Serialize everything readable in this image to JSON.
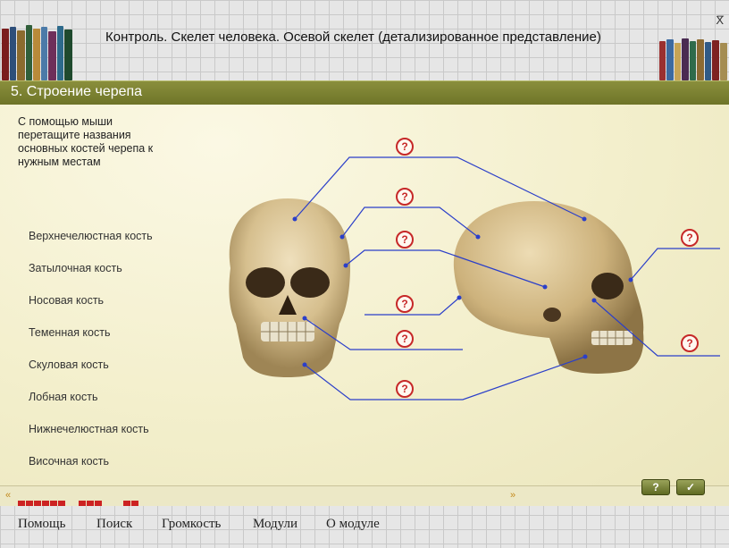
{
  "window": {
    "minimize": "_",
    "close": "X"
  },
  "title": "Контроль. Скелет человека. Осевой скелет (детализированное представление)",
  "section": {
    "title": "5. Строение черепа"
  },
  "instruction": "С помощью мыши перетащите названия основных костей черепа к нужным местам",
  "labels": [
    "Верхнечелюстная кость",
    "Затылочная кость",
    "Носовая кость",
    "Теменная кость",
    "Скуловая кость",
    "Лобная кость",
    "Нижнечелюстная кость",
    "Височная кость"
  ],
  "markers": [
    "?",
    "?",
    "?",
    "?",
    "?",
    "?",
    "?",
    "?"
  ],
  "nav": {
    "prev": "«",
    "next": "»"
  },
  "buttons": {
    "help": "?",
    "check": "✓"
  },
  "menu": [
    "Помощь",
    "Поиск",
    "Громкость",
    "Модули",
    "О модуле"
  ],
  "colors": {
    "accent": "#7a8030",
    "line": "#2b3fc9",
    "marker": "#c62828",
    "progress": "#cc2222"
  }
}
